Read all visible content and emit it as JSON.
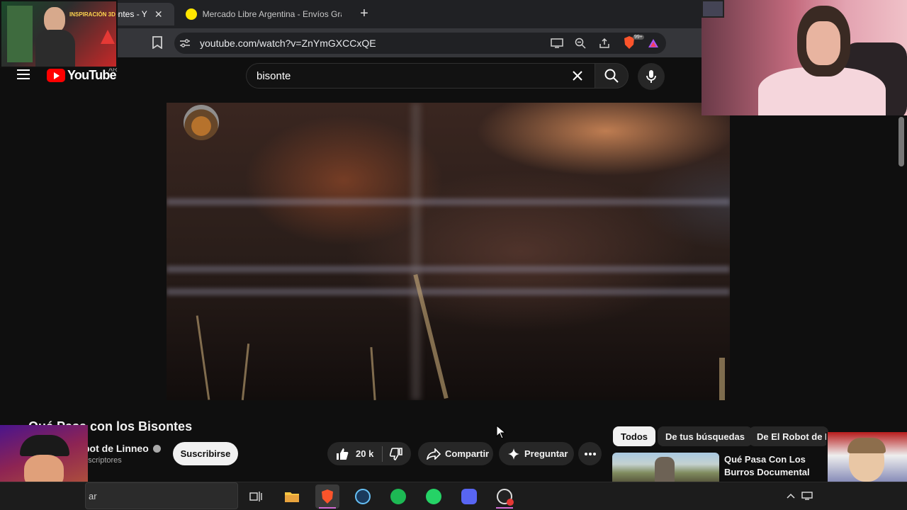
{
  "browser": {
    "tabs": [
      {
        "title": "ontes - Y",
        "active": true
      },
      {
        "title": "Mercado Libre Argentina - Envíos Gra",
        "active": false
      }
    ],
    "new_tab_label": "+",
    "url": "youtube.com/watch?v=ZnYmGXCCxQE",
    "shields_badge": "99+"
  },
  "youtube": {
    "logo_text": "YouTube",
    "country_code": "AR",
    "search_query": "bisonte"
  },
  "video": {
    "title": "Qué Pasa con los Bisontes",
    "channel_name": "bot de Linneo",
    "subscribers": "uscriptores",
    "subscribe_label": "Suscribirse",
    "likes": "20 k",
    "share_label": "Compartir",
    "ask_label": "Preguntar"
  },
  "sidebar": {
    "chips": [
      "Todos",
      "De tus búsquedas",
      "De El Robot de Li"
    ],
    "recommendation_title": "Qué Pasa Con Los Burros Documental"
  },
  "overlay": {
    "top_left_label": "INSPIRACIÓN 3D"
  },
  "taskbar": {
    "search_text": "ar",
    "apps": [
      "task-view",
      "file-explorer",
      "brave",
      "steam",
      "spotify",
      "whatsapp",
      "discord",
      "other"
    ]
  },
  "colors": {
    "youtube_red": "#ff0000",
    "background": "#0f0f0f",
    "chip_active": "#f1f1f1",
    "taskbar_indicator": "#d26bd5"
  }
}
